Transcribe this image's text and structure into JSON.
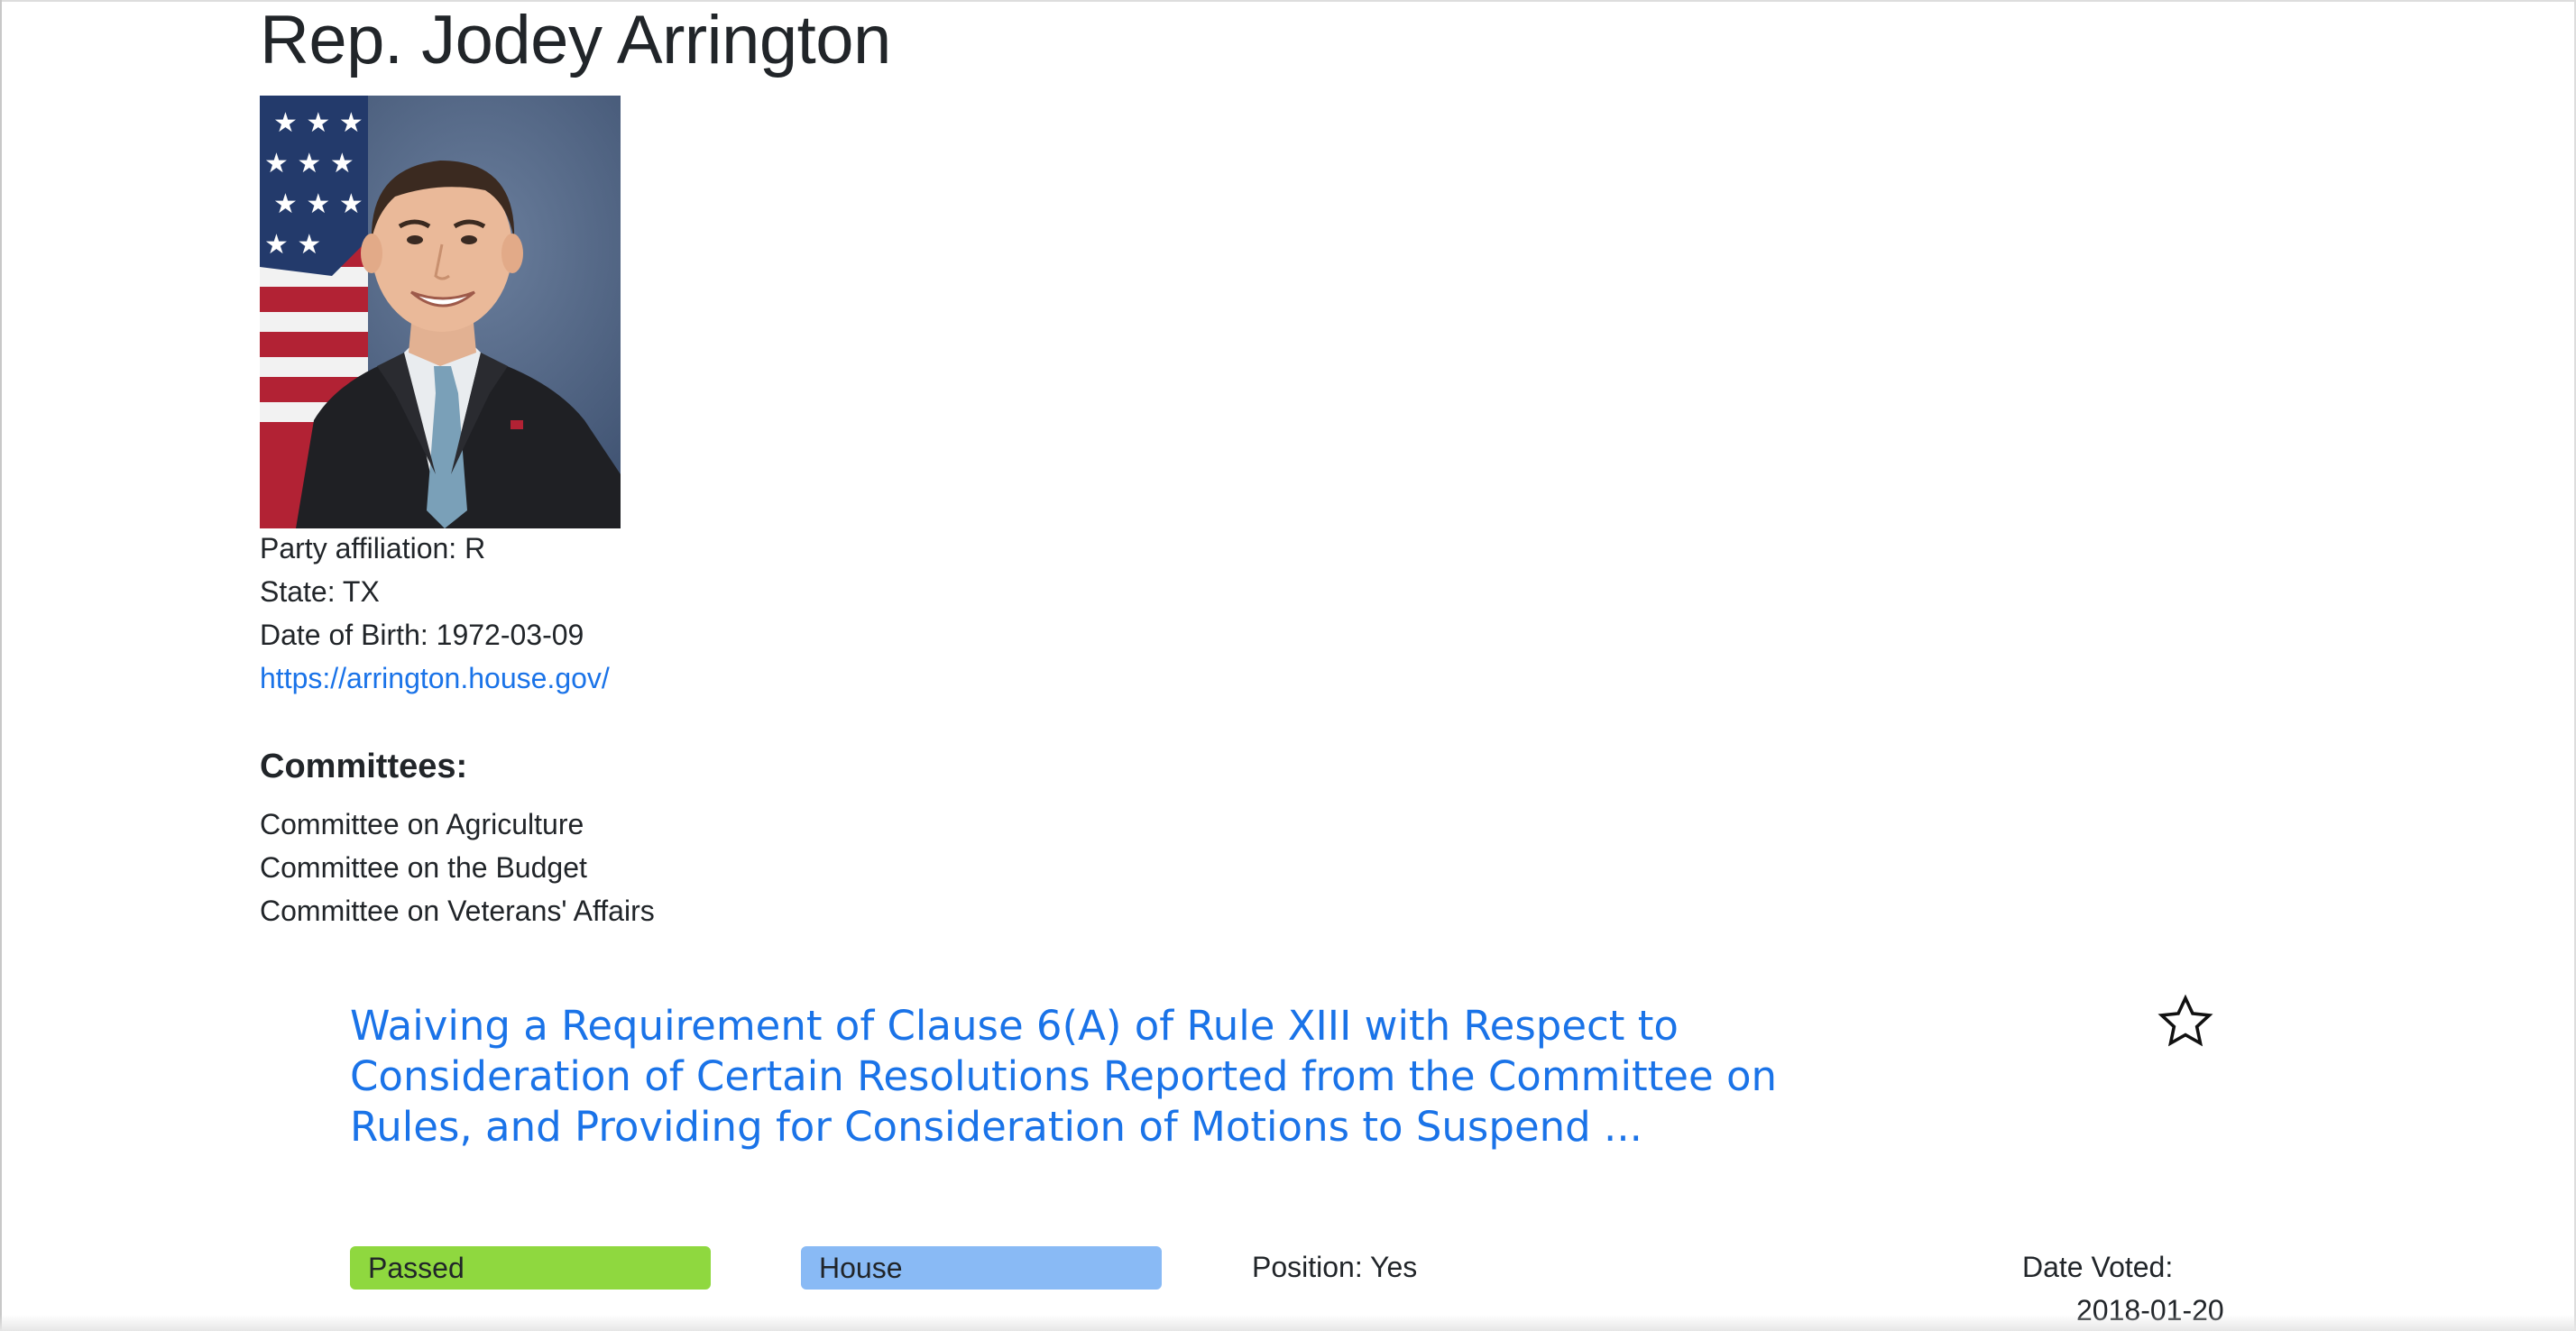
{
  "representative": {
    "name": "Rep. Jodey Arrington",
    "party_line": "Party affiliation: R",
    "state_line": "State: TX",
    "dob_line": "Date of Birth: 1972-03-09",
    "website": "https://arrington.house.gov/"
  },
  "committees": {
    "heading": "Committees:",
    "items": [
      "Committee on Agriculture",
      "Committee on the Budget",
      "Committee on Veterans' Affairs"
    ]
  },
  "vote": {
    "bill_title": "Waiving a Requirement of Clause 6(A) of Rule XIII with Respect to Consideration of Certain Resolutions Reported from the Committee on Rules, and Providing for Consideration of Motions to Suspend ...",
    "status": "Passed",
    "chamber": "House",
    "position": "Position: Yes",
    "date_label": "Date Voted:",
    "date_value": "2018-01-20",
    "favorite_icon": "star-outline-icon"
  },
  "colors": {
    "link": "#1a73e8",
    "status_passed": "#8fd83f",
    "chamber_house": "#89baf5"
  }
}
